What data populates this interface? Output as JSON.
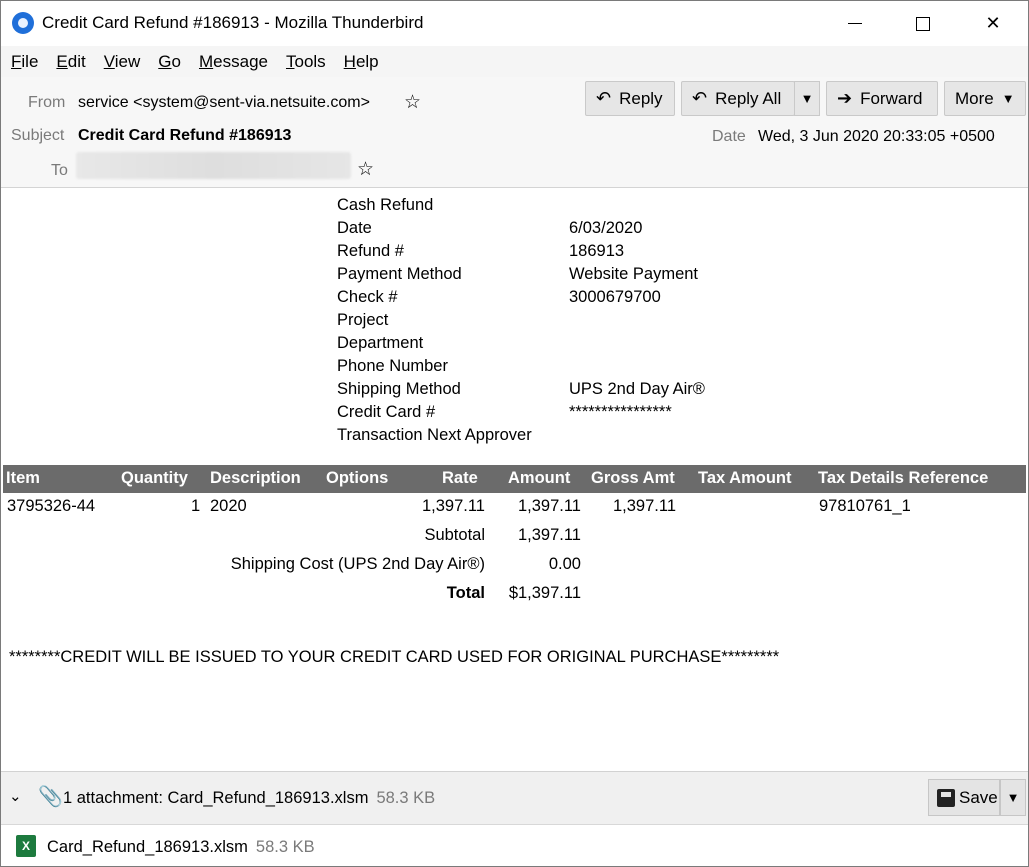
{
  "window": {
    "title": "Credit Card Refund #186913 - Mozilla Thunderbird",
    "app_icon": "thunderbird-icon"
  },
  "menu": [
    {
      "label": "File",
      "key": "F",
      "rest": "ile"
    },
    {
      "label": "Edit",
      "key": "E",
      "rest": "dit"
    },
    {
      "label": "View",
      "key": "V",
      "rest": "iew"
    },
    {
      "label": "Go",
      "key": "G",
      "rest": "o"
    },
    {
      "label": "Message",
      "key": "M",
      "rest": "essage"
    },
    {
      "label": "Tools",
      "key": "T",
      "rest": "ools"
    },
    {
      "label": "Help",
      "key": "H",
      "rest": "elp"
    }
  ],
  "toolbar": {
    "reply": "Reply",
    "reply_all": "Reply All",
    "forward": "Forward",
    "more": "More"
  },
  "header": {
    "from_label": "From",
    "from_value": "service <system@sent-via.netsuite.com>",
    "subject_label": "Subject",
    "subject_value": "Credit Card Refund #186913",
    "date_label": "Date",
    "date_value": "Wed, 3 Jun 2020 20:33:05 +0500",
    "to_label": "To"
  },
  "refund_info": [
    {
      "key": "Cash Refund",
      "value": ""
    },
    {
      "key": "Date",
      "value": "6/03/2020"
    },
    {
      "key": "Refund #",
      "value": "186913"
    },
    {
      "key": "Payment Method",
      "value": "Website Payment"
    },
    {
      "key": "Check #",
      "value": "3000679700"
    },
    {
      "key": "Project",
      "value": ""
    },
    {
      "key": "Department",
      "value": ""
    },
    {
      "key": "Phone Number",
      "value": ""
    },
    {
      "key": "Shipping Method",
      "value": "UPS 2nd Day Air®"
    },
    {
      "key": "Credit Card #",
      "value": "****************"
    },
    {
      "key": "Transaction Next Approver",
      "value": ""
    }
  ],
  "items_table": {
    "headers": {
      "item": "Item",
      "quantity": "Quantity",
      "description": "Description",
      "options": "Options",
      "rate": "Rate",
      "amount": "Amount",
      "gross_amt": "Gross Amt",
      "tax_amount": "Tax Amount",
      "tax_details_reference": "Tax Details Reference"
    },
    "rows": [
      {
        "item": "3795326-44",
        "quantity": "1",
        "description": "2020",
        "options": "",
        "rate": "1,397.11",
        "amount": "1,397.11",
        "gross_amt": "1,397.11",
        "tax_amount": "",
        "tax_details_reference": "97810761_1"
      }
    ],
    "subtotal_label": "Subtotal",
    "subtotal_value": "1,397.11",
    "shipping_label": "Shipping Cost (UPS 2nd Day Air®)",
    "shipping_value": "0.00",
    "total_label": "Total",
    "total_value": "$1,397.11"
  },
  "notice": "********CREDIT WILL BE ISSUED TO YOUR CREDIT CARD USED FOR ORIGINAL PURCHASE*********",
  "attachments": {
    "summary": "1 attachment: Card_Refund_186913.xlsm",
    "summary_size": "58.3 KB",
    "save_label": "Save",
    "files": [
      {
        "name": "Card_Refund_186913.xlsm",
        "size": "58.3 KB"
      }
    ]
  }
}
